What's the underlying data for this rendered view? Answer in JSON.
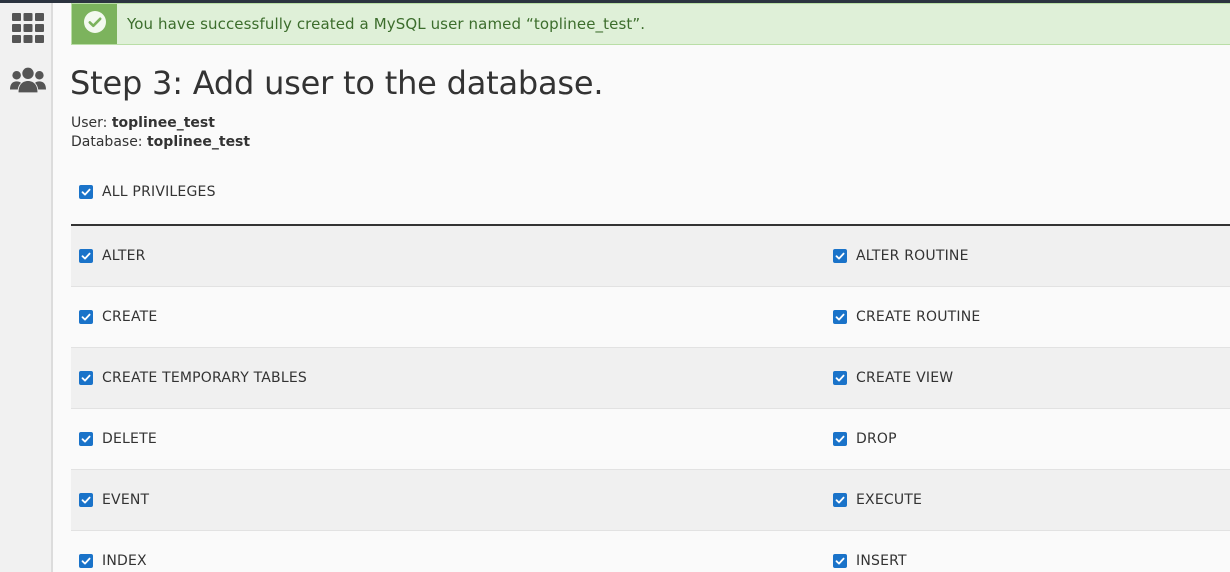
{
  "alert": {
    "message": "You have successfully created a MySQL user named “toplinee_test”.",
    "icon": "check-circle-icon"
  },
  "sidebar": {
    "items": [
      {
        "icon": "apps-grid-icon"
      },
      {
        "icon": "users-icon"
      }
    ]
  },
  "page": {
    "title": "Step 3: Add user to the database.",
    "user_label": "User:",
    "user_value": "toplinee_test",
    "db_label": "Database:",
    "db_value": "toplinee_test"
  },
  "all_privileges": {
    "label": "ALL PRIVILEGES",
    "checked": true
  },
  "privileges": [
    {
      "left": "ALTER",
      "right": "ALTER ROUTINE"
    },
    {
      "left": "CREATE",
      "right": "CREATE ROUTINE"
    },
    {
      "left": "CREATE TEMPORARY TABLES",
      "right": "CREATE VIEW"
    },
    {
      "left": "DELETE",
      "right": "DROP"
    },
    {
      "left": "EVENT",
      "right": "EXECUTE"
    },
    {
      "left": "INDEX",
      "right": "INSERT"
    }
  ],
  "colors": {
    "accent": "#1a73c9",
    "success_bg": "#dff0d8",
    "success_icon_bg": "#7cb35d",
    "success_text": "#3c6d2c"
  }
}
